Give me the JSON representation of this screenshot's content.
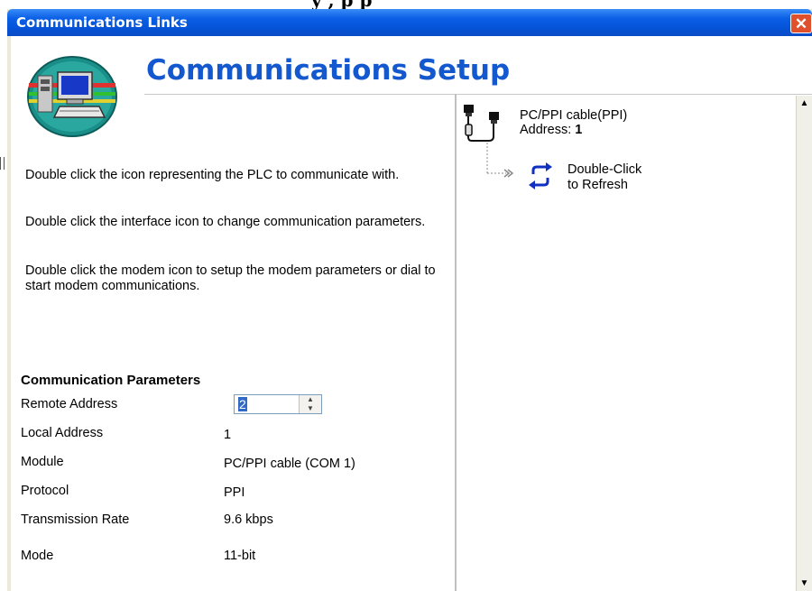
{
  "window": {
    "title": "Communications Links"
  },
  "header": {
    "heading": "Communications Setup"
  },
  "instructions": [
    "Double click the icon representing the PLC to communicate with.",
    "Double click the interface icon to change communication parameters.",
    "Double click the modem icon to setup the modem parameters or dial to start modem communications."
  ],
  "params": {
    "section_title": "Communication Parameters",
    "remote_address": {
      "label": "Remote Address",
      "value": "2"
    },
    "local_address": {
      "label": "Local Address",
      "value": "1"
    },
    "module": {
      "label": "Module",
      "value": "PC/PPI cable (COM 1)"
    },
    "protocol": {
      "label": "Protocol",
      "value": "PPI"
    },
    "rate": {
      "label": "Transmission Rate",
      "value": "9.6 kbps"
    },
    "mode": {
      "label": "Mode",
      "value": "11-bit"
    }
  },
  "tree": {
    "cable": {
      "name": "PC/PPI cable(PPI)",
      "address_label": "Address:",
      "address_value": "1"
    },
    "refresh": {
      "line1": "Double-Click",
      "line2": "to Refresh"
    }
  },
  "colors": {
    "title_bar": "#0553d8",
    "heading": "#1458d0",
    "close": "#e0502c",
    "selection": "#316ac5"
  }
}
